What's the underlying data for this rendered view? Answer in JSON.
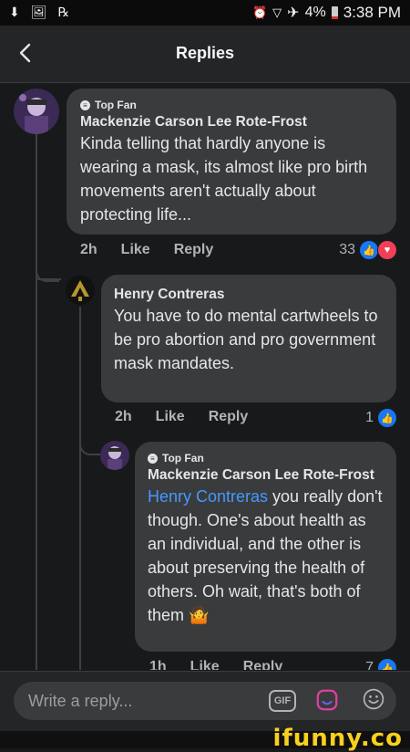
{
  "status_bar": {
    "time": "3:38 PM",
    "battery": "4%"
  },
  "header": {
    "title": "Replies"
  },
  "comments": [
    {
      "badge": "Top Fan",
      "author": "Mackenzie Carson Lee Rote-Frost",
      "text": "Kinda telling that hardly anyone is wearing a mask, its almost like pro birth movements aren't actually about protecting life...",
      "time": "2h",
      "like_label": "Like",
      "reply_label": "Reply",
      "reaction_count": "33"
    },
    {
      "author": "Henry Contreras",
      "text": "You have to do mental cartwheels to be pro abortion and pro government mask mandates.",
      "time": "2h",
      "like_label": "Like",
      "reply_label": "Reply",
      "reaction_count": "1"
    },
    {
      "badge": "Top Fan",
      "author": "Mackenzie Carson Lee Rote-Frost",
      "mention": "Henry Contreras",
      "text": " you really don't though. One's about health as an individual, and the other is about preserving the health of others. Oh wait, that's both of them",
      "emoji": "🤷",
      "time": "1h",
      "like_label": "Like",
      "reply_label": "Reply",
      "reaction_count": "7"
    }
  ],
  "composer": {
    "placeholder": "Write a reply...",
    "gif_label": "GIF"
  },
  "watermark": "ifunny.co"
}
